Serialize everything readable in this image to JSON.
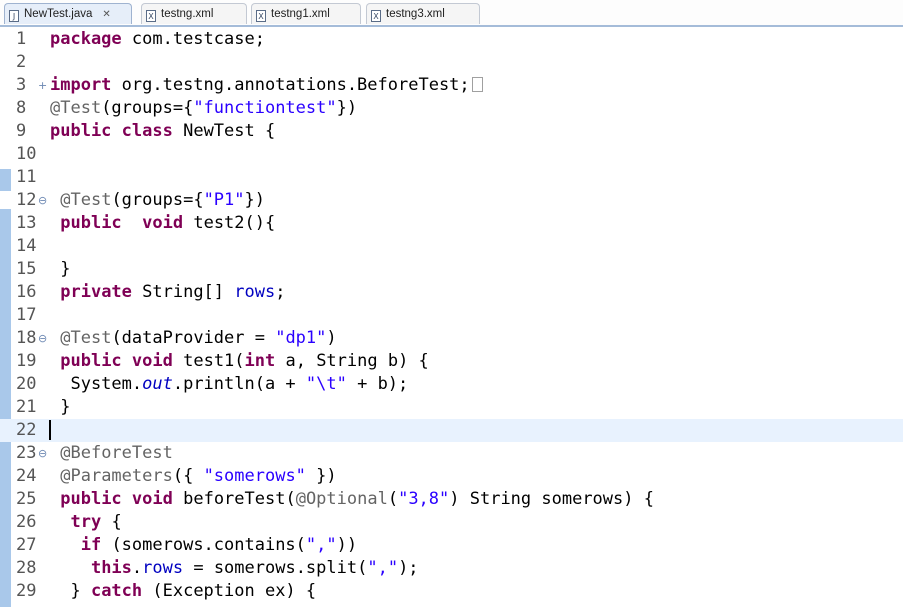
{
  "tabs": [
    {
      "label": "NewTest.java",
      "icon": "java-file-icon",
      "icon_glyph": "J",
      "active": true,
      "close": "✕"
    },
    {
      "label": "testng.xml",
      "icon": "xml-file-icon",
      "icon_glyph": "X",
      "active": false
    },
    {
      "label": "testng1.xml",
      "icon": "xml-file-icon",
      "icon_glyph": "X",
      "active": false
    },
    {
      "label": "testng3.xml",
      "icon": "xml-file-icon",
      "icon_glyph": "X",
      "active": false
    }
  ],
  "editor": {
    "current_line": 22,
    "lines": [
      {
        "no": "1",
        "fold": "",
        "tokens": [
          {
            "t": "package",
            "c": "kw"
          },
          {
            "t": " com.testcase;"
          }
        ]
      },
      {
        "no": "2",
        "fold": "",
        "tokens": []
      },
      {
        "no": "3",
        "fold": "+",
        "tokens": [
          {
            "t": "import",
            "c": "kw"
          },
          {
            "t": " org.testng.annotations.BeforeTest;"
          }
        ],
        "collapsed": true
      },
      {
        "no": "8",
        "fold": "",
        "tokens": [
          {
            "t": "@Test",
            "c": "ann"
          },
          {
            "t": "(groups={"
          },
          {
            "t": "\"functiontest\"",
            "c": "str"
          },
          {
            "t": "})"
          }
        ]
      },
      {
        "no": "9",
        "fold": "",
        "tokens": [
          {
            "t": "public",
            "c": "kw"
          },
          {
            "t": " "
          },
          {
            "t": "class",
            "c": "kw"
          },
          {
            "t": " NewTest {"
          }
        ]
      },
      {
        "no": "10",
        "fold": "",
        "tokens": []
      },
      {
        "no": "11",
        "fold": "",
        "tokens": []
      },
      {
        "no": "12",
        "fold": "⊖",
        "tokens": [
          {
            "t": " "
          },
          {
            "t": "@Test",
            "c": "ann"
          },
          {
            "t": "(groups={"
          },
          {
            "t": "\"P1\"",
            "c": "str"
          },
          {
            "t": "})"
          }
        ]
      },
      {
        "no": "13",
        "fold": "",
        "tokens": [
          {
            "t": " "
          },
          {
            "t": "public",
            "c": "kw"
          },
          {
            "t": "  "
          },
          {
            "t": "void",
            "c": "kw"
          },
          {
            "t": " test2(){"
          }
        ]
      },
      {
        "no": "14",
        "fold": "",
        "tokens": []
      },
      {
        "no": "15",
        "fold": "",
        "tokens": [
          {
            "t": " }"
          }
        ]
      },
      {
        "no": "16",
        "fold": "",
        "tokens": [
          {
            "t": " "
          },
          {
            "t": "private",
            "c": "kw"
          },
          {
            "t": " String[] "
          },
          {
            "t": "rows",
            "c": "fld"
          },
          {
            "t": ";"
          }
        ]
      },
      {
        "no": "17",
        "fold": "",
        "tokens": []
      },
      {
        "no": "18",
        "fold": "⊖",
        "tokens": [
          {
            "t": " "
          },
          {
            "t": "@Test",
            "c": "ann"
          },
          {
            "t": "(dataProvider = "
          },
          {
            "t": "\"dp1\"",
            "c": "str"
          },
          {
            "t": ")"
          }
        ]
      },
      {
        "no": "19",
        "fold": "",
        "tokens": [
          {
            "t": " "
          },
          {
            "t": "public",
            "c": "kw"
          },
          {
            "t": " "
          },
          {
            "t": "void",
            "c": "kw"
          },
          {
            "t": " test1("
          },
          {
            "t": "int",
            "c": "kw"
          },
          {
            "t": " a, String b) {"
          }
        ]
      },
      {
        "no": "20",
        "fold": "",
        "tokens": [
          {
            "t": "  System."
          },
          {
            "t": "out",
            "c": "sfld"
          },
          {
            "t": ".println(a + "
          },
          {
            "t": "\"\\t\"",
            "c": "str"
          },
          {
            "t": " + b);"
          }
        ]
      },
      {
        "no": "21",
        "fold": "",
        "tokens": [
          {
            "t": " }"
          }
        ]
      },
      {
        "no": "22",
        "fold": "",
        "tokens": [],
        "caret": true
      },
      {
        "no": "23",
        "fold": "⊖",
        "tokens": [
          {
            "t": " "
          },
          {
            "t": "@BeforeTest",
            "c": "ann"
          }
        ]
      },
      {
        "no": "24",
        "fold": "",
        "tokens": [
          {
            "t": " "
          },
          {
            "t": "@Parameters",
            "c": "ann"
          },
          {
            "t": "({ "
          },
          {
            "t": "\"somerows\"",
            "c": "str"
          },
          {
            "t": " })"
          }
        ]
      },
      {
        "no": "25",
        "fold": "",
        "tokens": [
          {
            "t": " "
          },
          {
            "t": "public",
            "c": "kw"
          },
          {
            "t": " "
          },
          {
            "t": "void",
            "c": "kw"
          },
          {
            "t": " beforeTest("
          },
          {
            "t": "@Optional",
            "c": "ann"
          },
          {
            "t": "("
          },
          {
            "t": "\"3,8\"",
            "c": "str"
          },
          {
            "t": ") String somerows) {"
          }
        ]
      },
      {
        "no": "26",
        "fold": "",
        "tokens": [
          {
            "t": "  "
          },
          {
            "t": "try",
            "c": "kw"
          },
          {
            "t": " {"
          }
        ]
      },
      {
        "no": "27",
        "fold": "",
        "tokens": [
          {
            "t": "   "
          },
          {
            "t": "if",
            "c": "kw"
          },
          {
            "t": " (somerows.contains("
          },
          {
            "t": "\",\"",
            "c": "str"
          },
          {
            "t": "))"
          }
        ]
      },
      {
        "no": "28",
        "fold": "",
        "tokens": [
          {
            "t": "    "
          },
          {
            "t": "this",
            "c": "kw"
          },
          {
            "t": "."
          },
          {
            "t": "rows",
            "c": "fld"
          },
          {
            "t": " = somerows.split("
          },
          {
            "t": "\",\"",
            "c": "str"
          },
          {
            "t": ");"
          }
        ]
      },
      {
        "no": "29",
        "fold": "",
        "tokens": [
          {
            "t": "  } "
          },
          {
            "t": "catch",
            "c": "kw"
          },
          {
            "t": " (Exception ex) {"
          }
        ]
      }
    ]
  }
}
